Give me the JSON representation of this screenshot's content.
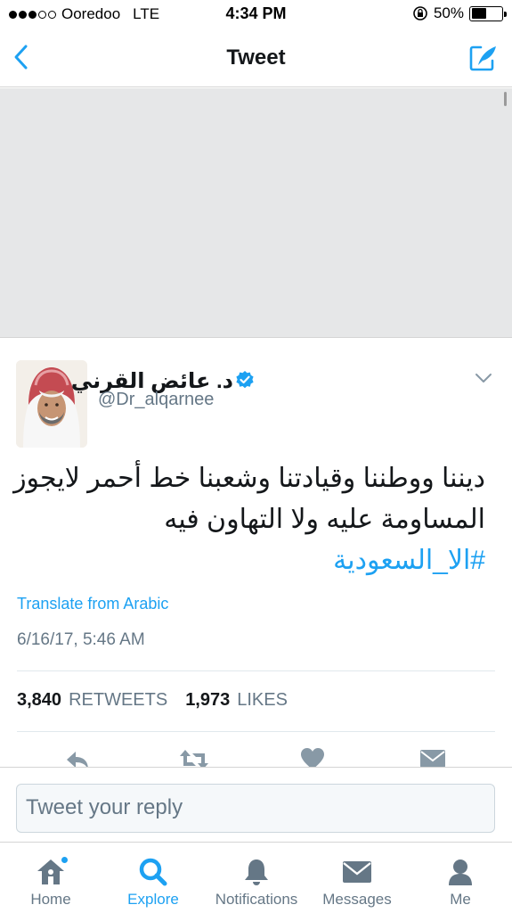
{
  "status_bar": {
    "carrier": "Ooredoo",
    "network": "LTE",
    "time": "4:34 PM",
    "battery_percent": "50%",
    "battery_level": 0.5,
    "signal_bars_filled": 3,
    "signal_bars_total": 5
  },
  "nav": {
    "title": "Tweet",
    "back_icon": "chevron-left-icon",
    "compose_icon": "compose-tweet-icon",
    "accent_color": "#1da1f2"
  },
  "tweet": {
    "display_name": "د. عائض القرني",
    "handle": "@Dr_alqarnee",
    "verified": true,
    "text_lines": [
      "ديننا ووطننا وقيادتنا وشعبنا خط أحمر لايجوز",
      "المساومة عليه ولا التهاون فيه"
    ],
    "hashtag": "#الا_السعودية",
    "translate_label": "Translate from Arabic",
    "timestamp": "6/16/17, 5:46 AM",
    "retweets_count": "3,840",
    "retweets_label": "RETWEETS",
    "likes_count": "1,973",
    "likes_label": "LIKES"
  },
  "reply": {
    "placeholder": "Tweet your reply"
  },
  "tabs": [
    {
      "label": "Home",
      "icon": "home-icon",
      "active": false,
      "has_dot": true
    },
    {
      "label": "Explore",
      "icon": "search-icon",
      "active": true,
      "has_dot": false
    },
    {
      "label": "Notifications",
      "icon": "bell-icon",
      "active": false,
      "has_dot": false
    },
    {
      "label": "Messages",
      "icon": "envelope-icon",
      "active": false,
      "has_dot": false
    },
    {
      "label": "Me",
      "icon": "person-icon",
      "active": false,
      "has_dot": false
    }
  ]
}
